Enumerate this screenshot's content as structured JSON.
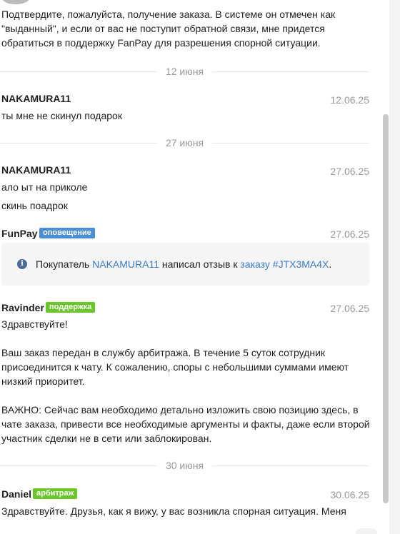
{
  "messages": {
    "prev_text": "Подтвердите, пожалуйста, получение заказа. В системе он отмечен как\n\"выданный\", и если от вас не поступит обратной связи, мне придется\nобратиться в поддержку FanPay для разрешения спорной ситуации.",
    "divider1": "12 июня",
    "m1_author": "NAKAMURA11",
    "m1_time": "12.06.25",
    "m1_text": "ты мне не скинул подарок",
    "divider2": "27 июня",
    "m2_author": "NAKAMURA11",
    "m2_time": "27.06.25",
    "m2_line1": "ало ыт на приколе",
    "m2_line2": "скинь поадрок",
    "m3_author": "FunPay",
    "m3_badge": "оповещение",
    "m3_time": "27.06.25",
    "notice_prefix": "Покупатель ",
    "notice_user": "NAKAMURA11",
    "notice_middle": " написал отзыв к ",
    "notice_link": "заказу #JTX3MA4X",
    "notice_suffix": ".",
    "m4_author": "Ravinder",
    "m4_badge": "поддержка",
    "m4_time": "27.06.25",
    "m4_p1": "Здравствуйте!",
    "m4_p2": "Ваш заказ передан в службу арбитража. В течение 5 суток сотрудник\nприсоединится к чату. К сожалению, споры с небольшими суммами имеют\nнизкий приоритет.",
    "m4_p3": "ВАЖНО: Сейчас вам необходимо детально изложить свою позицию здесь, в\nчате заказа, привести все необходимые аргументы и факты, даже если второй\nучастник сделки не в сети или заблокирован.",
    "divider3": "30 июня",
    "m5_author": "Daniel",
    "m5_badge": "арбитраж",
    "m5_time": "30.06.25",
    "m5_text": "Здравствуйте. Друзья, как я вижу, у вас возникла спорная ситуация. Меня"
  },
  "colors": {
    "notification_badge": "#4a8fd6",
    "support_badge": "#6ac62a",
    "link": "#3b7cc9"
  },
  "icons": {
    "notice": "info-icon"
  }
}
